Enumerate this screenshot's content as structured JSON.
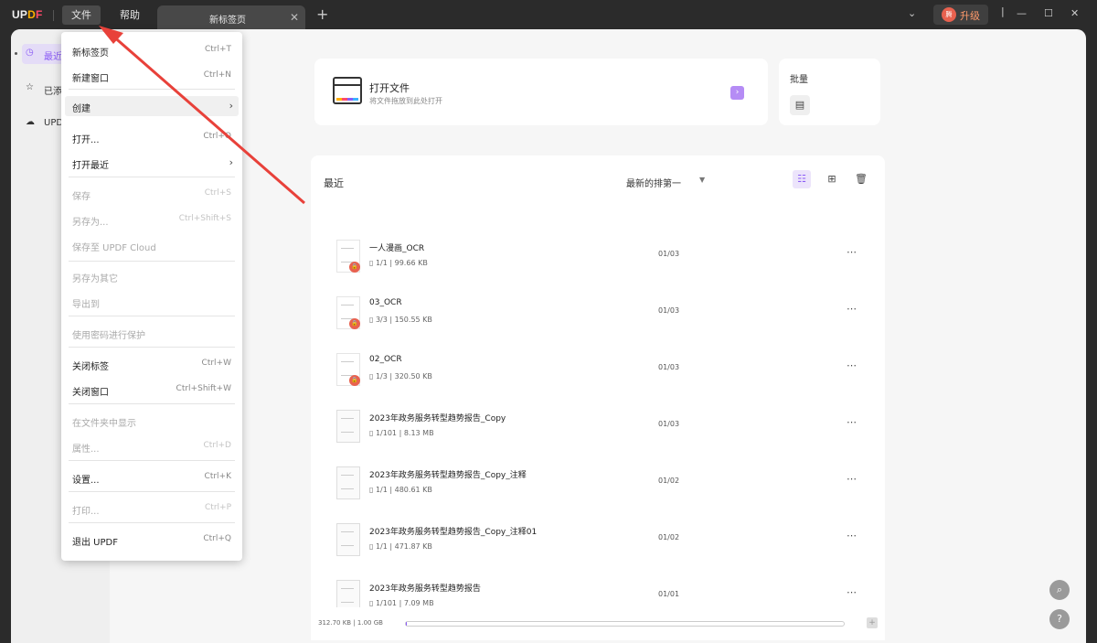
{
  "app": {
    "logo_up": "UP",
    "logo_d1": "D",
    "logo_d2": "F",
    "menu": [
      "文件",
      "帮助"
    ],
    "tab_title": "新标签页",
    "upgrade_label": "升级",
    "avatar_text": "腾"
  },
  "sidebar": {
    "items": [
      {
        "label": "最近",
        "icon": "clock-icon"
      },
      {
        "label": "已添",
        "icon": "star-icon"
      },
      {
        "label": "UPD",
        "icon": "cloud-icon"
      }
    ]
  },
  "open_card": {
    "title": "打开文件",
    "subtitle": "将文件拖放到此处打开",
    "arrow": "›"
  },
  "batch_card": {
    "title": "批量"
  },
  "recent": {
    "title": "最近",
    "sort_label": "最新的排第一",
    "files": [
      {
        "name": "一人漫画_OCR",
        "pages": "1/1",
        "size": "99.66 KB",
        "date": "01/03",
        "locked": true
      },
      {
        "name": "03_OCR",
        "pages": "3/3",
        "size": "150.55 KB",
        "date": "01/03",
        "locked": true
      },
      {
        "name": "02_OCR",
        "pages": "1/3",
        "size": "320.50 KB",
        "date": "01/03",
        "locked": true
      },
      {
        "name": "2023年政务服务转型趋势报告_Copy",
        "pages": "1/101",
        "size": "8.13 MB",
        "date": "01/03",
        "locked": false
      },
      {
        "name": "2023年政务服务转型趋势报告_Copy_注释",
        "pages": "1/1",
        "size": "480.61 KB",
        "date": "01/02",
        "locked": false
      },
      {
        "name": "2023年政务服务转型趋势报告_Copy_注释01",
        "pages": "1/1",
        "size": "471.87 KB",
        "date": "01/02",
        "locked": false
      },
      {
        "name": "2023年政务服务转型趋势报告",
        "pages": "1/101",
        "size": "7.09 MB",
        "date": "01/01",
        "locked": false
      }
    ]
  },
  "storage": {
    "label": "312.70 KB | 1.00 GB",
    "used_fraction": 0.0003
  },
  "dropdown": {
    "items": [
      {
        "label": "新标签页",
        "shortcut": "Ctrl+T",
        "disabled": false
      },
      {
        "label": "新建窗口",
        "shortcut": "Ctrl+N",
        "disabled": false
      },
      {
        "label": "创建",
        "shortcut": "",
        "disabled": false,
        "submenu": true,
        "hover": true
      },
      {
        "label": "打开...",
        "shortcut": "Ctrl+O",
        "disabled": false
      },
      {
        "label": "打开最近",
        "shortcut": "",
        "disabled": false,
        "submenu": true
      },
      {
        "label": "保存",
        "shortcut": "Ctrl+S",
        "disabled": true
      },
      {
        "label": "另存为...",
        "shortcut": "Ctrl+Shift+S",
        "disabled": true
      },
      {
        "label": "保存至 UPDF Cloud",
        "shortcut": "",
        "disabled": true
      },
      {
        "label": "另存为其它",
        "shortcut": "",
        "disabled": true
      },
      {
        "label": "导出到",
        "shortcut": "",
        "disabled": true
      },
      {
        "label": "使用密码进行保护",
        "shortcut": "",
        "disabled": true
      },
      {
        "label": "关闭标签",
        "shortcut": "Ctrl+W",
        "disabled": false
      },
      {
        "label": "关闭窗口",
        "shortcut": "Ctrl+Shift+W",
        "disabled": false
      },
      {
        "label": "在文件夹中显示",
        "shortcut": "",
        "disabled": true
      },
      {
        "label": "属性...",
        "shortcut": "Ctrl+D",
        "disabled": true
      },
      {
        "label": "设置...",
        "shortcut": "Ctrl+K",
        "disabled": false
      },
      {
        "label": "打印...",
        "shortcut": "Ctrl+P",
        "disabled": true
      },
      {
        "label": "退出 UPDF",
        "shortcut": "Ctrl+Q",
        "disabled": false
      }
    ]
  },
  "colors": {
    "accent": "#8b5cf6",
    "annotation_arrow": "#e8413a"
  }
}
